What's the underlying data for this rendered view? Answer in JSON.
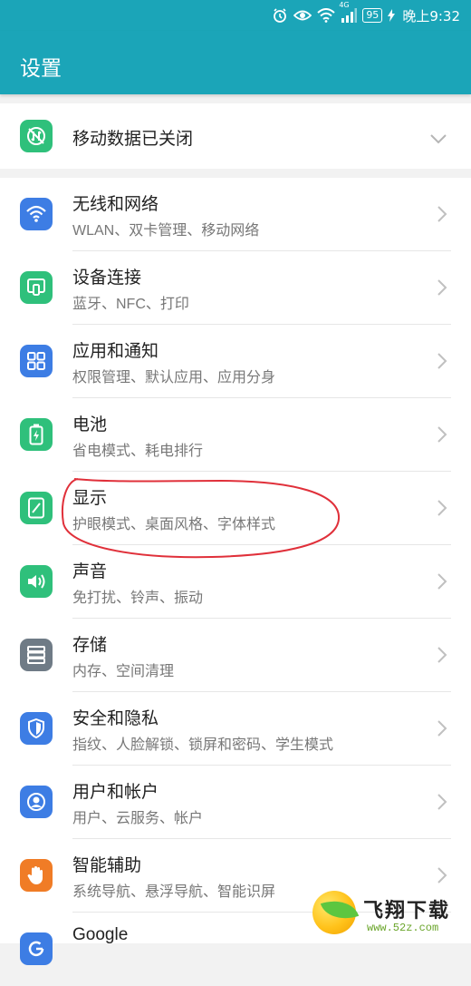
{
  "status_bar": {
    "battery": "95",
    "network": "4G",
    "time": "晚上9:32",
    "icons": [
      "alarm-icon",
      "eye-icon",
      "wifi-icon",
      "signal-icon",
      "battery-icon",
      "charging-icon"
    ]
  },
  "app_bar": {
    "title": "设置"
  },
  "mobile_data": {
    "label": "移动数据已关闭",
    "icon": "mobile-data-off-icon"
  },
  "settings_items": [
    {
      "title": "无线和网络",
      "subtitle": "WLAN、双卡管理、移动网络",
      "icon": "wifi-icon",
      "color": "#3d7de4"
    },
    {
      "title": "设备连接",
      "subtitle": "蓝牙、NFC、打印",
      "icon": "device-connection-icon",
      "color": "#2fc07b"
    },
    {
      "title": "应用和通知",
      "subtitle": "权限管理、默认应用、应用分身",
      "icon": "apps-icon",
      "color": "#3d7de4"
    },
    {
      "title": "电池",
      "subtitle": "省电模式、耗电排行",
      "icon": "battery-icon",
      "color": "#2fc07b"
    },
    {
      "title": "显示",
      "subtitle": "护眼模式、桌面风格、字体样式",
      "icon": "display-icon",
      "color": "#2fc07b"
    },
    {
      "title": "声音",
      "subtitle": "免打扰、铃声、振动",
      "icon": "sound-icon",
      "color": "#2fc07b"
    },
    {
      "title": "存储",
      "subtitle": "内存、空间清理",
      "icon": "storage-icon",
      "color": "#6f7b86"
    },
    {
      "title": "安全和隐私",
      "subtitle": "指纹、人脸解锁、锁屏和密码、学生模式",
      "icon": "shield-icon",
      "color": "#3d7de4"
    },
    {
      "title": "用户和帐户",
      "subtitle": "用户、云服务、帐户",
      "icon": "user-icon",
      "color": "#3d7de4"
    },
    {
      "title": "智能辅助",
      "subtitle": "系统导航、悬浮导航、智能识屏",
      "icon": "hand-icon",
      "color": "#f07c26"
    },
    {
      "title": "Google",
      "subtitle": "",
      "icon": "google-icon",
      "color": "#3d7de4"
    }
  ],
  "watermark": {
    "name": "飞翔下载",
    "url": "www.52z.com"
  },
  "colors": {
    "accent": "#1ba5b8",
    "annotation": "#e0303a"
  }
}
